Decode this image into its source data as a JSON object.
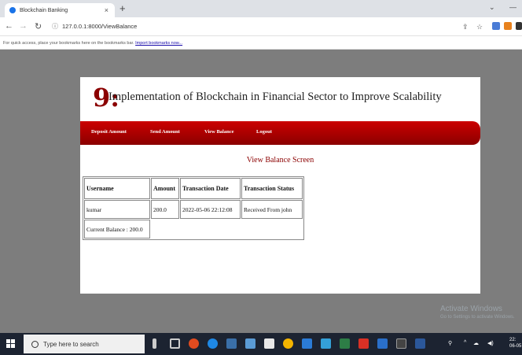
{
  "browser": {
    "tab_title": "Blockchain Banking",
    "tab_close": "×",
    "new_tab": "+",
    "url": "127.0.0.1:8000/ViewBalance",
    "bookmarks_text": "For quick access, place your bookmarks here on the bookmarks bar.",
    "bookmarks_link": "Import bookmarks now..."
  },
  "page": {
    "logo": "9:",
    "title": "Implementation of Blockchain in Financial Sector to Improve Scalability",
    "menu": [
      "Deposit Amount",
      "Send Amount",
      "View Balance",
      "Logout"
    ],
    "screen_title": "View Balance Screen",
    "table": {
      "headers": [
        "Username",
        "Amount",
        "Transaction Date",
        "Transaction Status"
      ],
      "rows": [
        [
          "kumar",
          "200.0",
          "2022-05-06 22:12:08",
          "Received From john"
        ]
      ],
      "current_balance": "Current Balance : 200.0"
    }
  },
  "watermark": {
    "line1": "Activate Windows",
    "line2": "Go to Settings to activate Windows."
  },
  "taskbar": {
    "search_placeholder": "Type here to search",
    "time": "22:",
    "date": "06-05"
  },
  "colors": {
    "menu_red": "#b30000",
    "accent_text": "#8b0000"
  }
}
